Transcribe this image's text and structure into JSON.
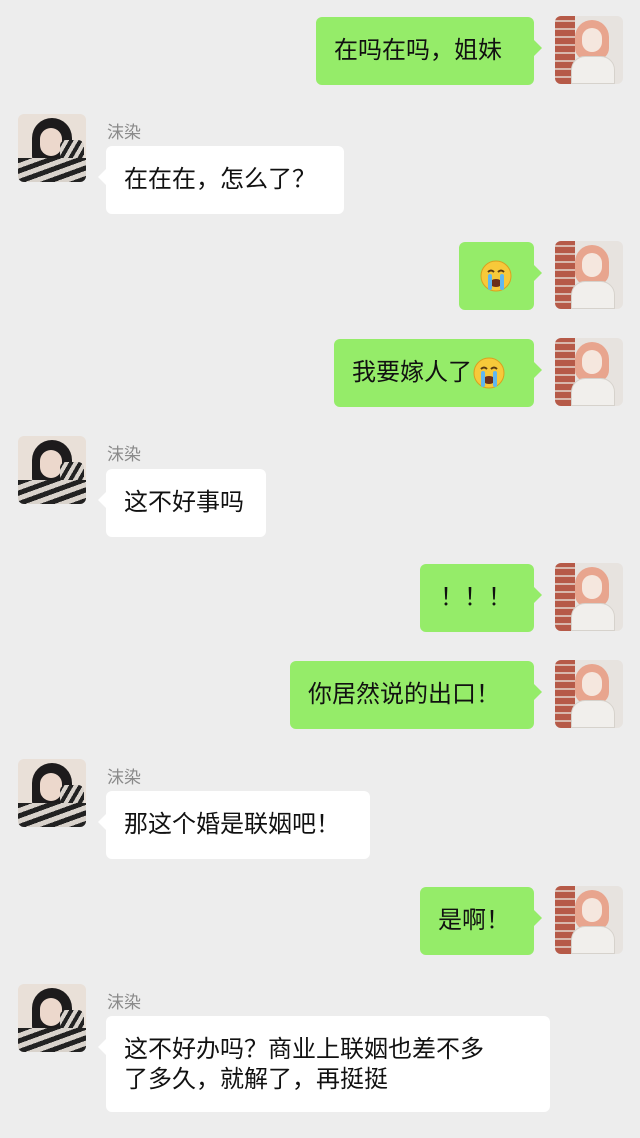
{
  "colors": {
    "background": "#ededed",
    "bubble_self": "#95ec69",
    "bubble_other": "#ffffff",
    "name_text": "#8a8a8a"
  },
  "contact": {
    "name": "沫染"
  },
  "messages": [
    {
      "side": "right",
      "text": "在吗在吗，姐妹"
    },
    {
      "side": "left",
      "name": "沫染",
      "text": "在在在，怎么了？"
    },
    {
      "side": "right",
      "text": "",
      "emoji": "crying-face-emoji"
    },
    {
      "side": "right",
      "text": "我要嫁人了",
      "emoji": "crying-face-emoji"
    },
    {
      "side": "left",
      "name": "沫染",
      "text": "这不好事吗"
    },
    {
      "side": "right",
      "text": "！！！"
    },
    {
      "side": "right",
      "text": "你居然说的出口！"
    },
    {
      "side": "left",
      "name": "沫染",
      "text": "那这个婚是联姻吧！"
    },
    {
      "side": "right",
      "text": "是啊！"
    },
    {
      "side": "left",
      "name": "沫染",
      "text_lines": [
        "这不好办吗？商业上联姻也差不多",
        "了多久，就解了，再挺挺"
      ]
    }
  ]
}
